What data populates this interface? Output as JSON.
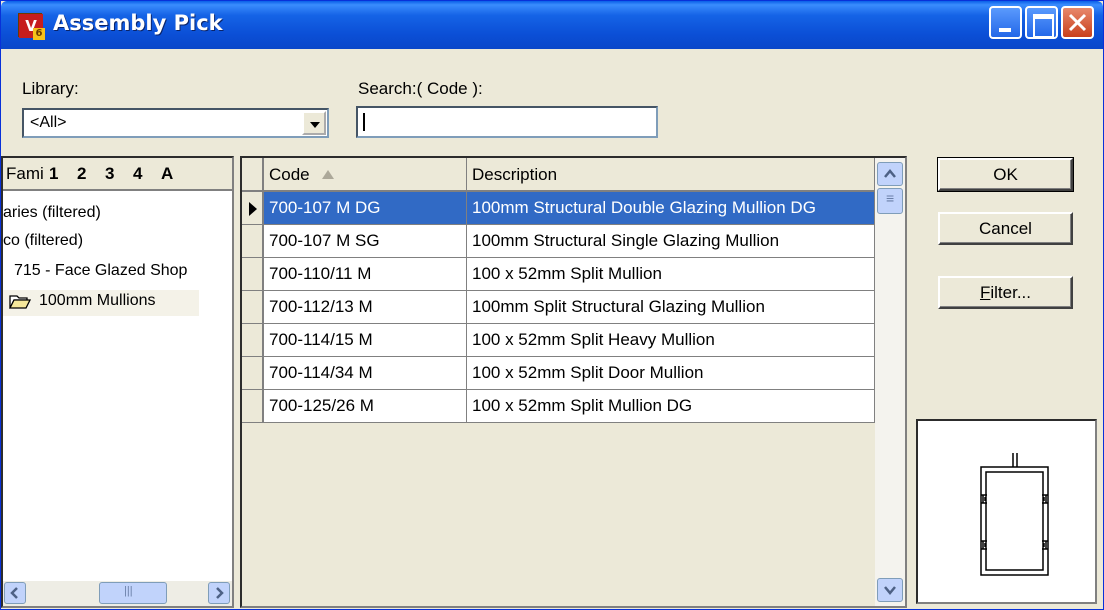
{
  "window": {
    "title": "Assembly Pick"
  },
  "library": {
    "label": "Library:",
    "value": "<All>"
  },
  "search": {
    "label": "Search:( Code ):",
    "value": ""
  },
  "tree": {
    "header": {
      "label": "Fami",
      "tabs": [
        "1",
        "2",
        "3",
        "4",
        "A"
      ]
    },
    "items": [
      {
        "label": "aries (filtered)"
      },
      {
        "label": "co (filtered)"
      },
      {
        "label": "715 - Face Glazed Shop"
      },
      {
        "label": "100mm Mullions"
      }
    ]
  },
  "grid": {
    "columns": [
      "Code",
      "Description"
    ],
    "rows": [
      {
        "code": "700-107 M DG",
        "description": "100mm Structural Double Glazing Mullion DG",
        "selected": true
      },
      {
        "code": "700-107 M SG",
        "description": "100mm Structural Single Glazing Mullion"
      },
      {
        "code": "700-110/11 M",
        "description": "100 x 52mm Split Mullion"
      },
      {
        "code": "700-112/13 M",
        "description": "100mm Split Structural Glazing Mullion"
      },
      {
        "code": "700-114/15 M",
        "description": "100 x 52mm Split Heavy Mullion"
      },
      {
        "code": "700-114/34 M",
        "description": "100 x 52mm Split Door Mullion"
      },
      {
        "code": "700-125/26 M",
        "description": "100 x 52mm Split Mullion DG"
      }
    ]
  },
  "buttons": {
    "ok": "OK",
    "cancel": "Cancel",
    "filter_prefix": "F",
    "filter_rest": "ilter..."
  },
  "colors": {
    "title_bar": "#0a47c9",
    "selection": "#316ac5",
    "face": "#ece9d8"
  },
  "icons": {
    "app": "v6-app-icon",
    "folder": "open-folder-icon",
    "row_pointer": "current-row-icon"
  }
}
